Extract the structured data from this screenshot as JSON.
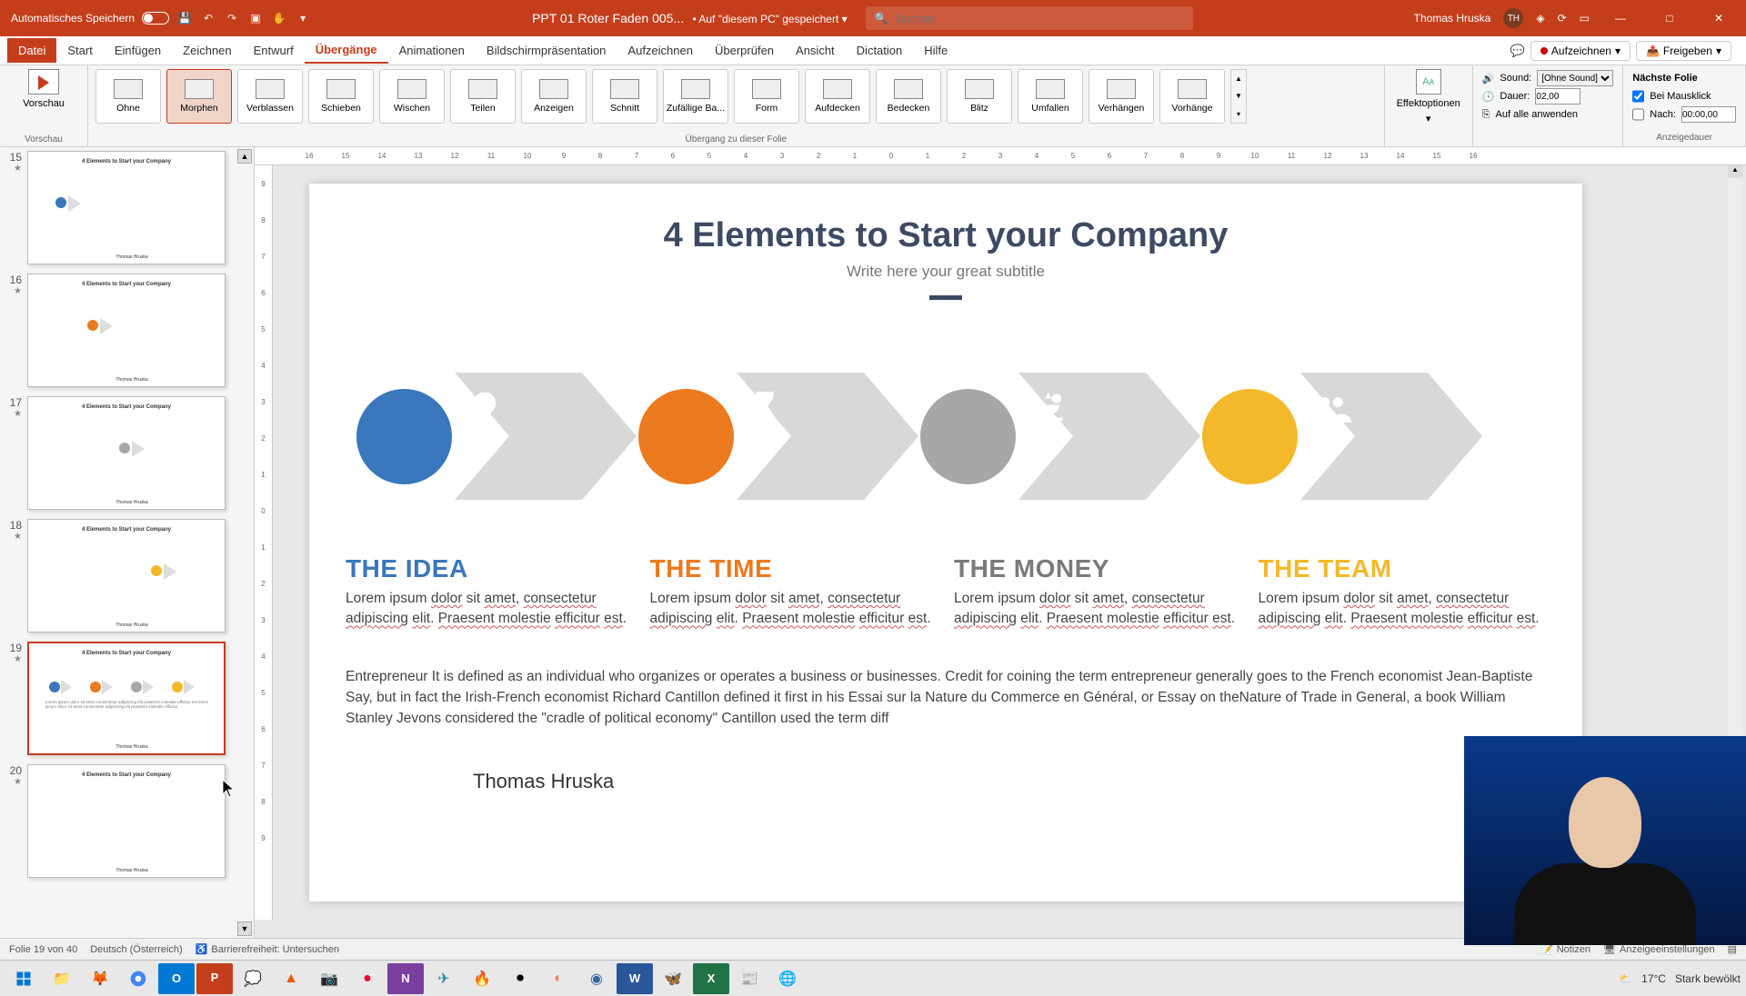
{
  "titlebar": {
    "autosave": "Automatisches Speichern",
    "filename": "PPT 01 Roter Faden 005...",
    "savedloc": "• Auf \"diesem PC\" gespeichert",
    "search_placeholder": "Suchen",
    "user": "Thomas Hruska",
    "user_initials": "TH"
  },
  "tabs": {
    "file": "Datei",
    "start": "Start",
    "insert": "Einfügen",
    "draw": "Zeichnen",
    "design": "Entwurf",
    "transitions": "Übergänge",
    "animations": "Animationen",
    "slideshow": "Bildschirmpräsentation",
    "record": "Aufzeichnen",
    "review": "Überprüfen",
    "view": "Ansicht",
    "dictation": "Dictation",
    "help": "Hilfe",
    "recordBtn": "Aufzeichnen",
    "shareBtn": "Freigeben"
  },
  "ribbon": {
    "preview": "Vorschau",
    "trans": [
      "Ohne",
      "Morphen",
      "Verblassen",
      "Schieben",
      "Wischen",
      "Teilen",
      "Anzeigen",
      "Schnitt",
      "Zufällige Ba...",
      "Form",
      "Aufdecken",
      "Bedecken",
      "Blitz",
      "Umfallen",
      "Verhängen",
      "Vorhänge"
    ],
    "effectOptions": "Effektoptionen",
    "groupLabel": "Übergang zu dieser Folie",
    "sound": "Sound:",
    "soundVal": "[Ohne Sound]",
    "duration": "Dauer:",
    "durationVal": "02,00",
    "applyAll": "Auf alle anwenden",
    "nextSlide": "Nächste Folie",
    "onClick": "Bei Mausklick",
    "after": "Nach:",
    "afterVal": "00:00,00",
    "timingLabel": "Anzeigedauer"
  },
  "thumbs": {
    "nums": [
      "15",
      "16",
      "17",
      "18",
      "19",
      "20"
    ],
    "title": "4 Elements to Start your Company",
    "author": "Thomas Hruska"
  },
  "slide": {
    "title": "4 Elements to Start your Company",
    "subtitle": "Write here your great subtitle",
    "cols": [
      {
        "h": "THE IDEA",
        "c": "blue"
      },
      {
        "h": "THE TIME",
        "c": "orange"
      },
      {
        "h": "THE MONEY",
        "c": "gray"
      },
      {
        "h": "THE TEAM",
        "c": "yellow"
      }
    ],
    "lorem1": "Lorem ipsum ",
    "lorem_u1": "dolor",
    "lorem2": " sit ",
    "lorem_u2": "amet",
    "lorem3": ", ",
    "lorem_u3": "consectetur adipiscing",
    "lorem4": " ",
    "lorem_u4": "elit",
    "lorem5": ". ",
    "lorem_u5": "Praesent molestie",
    "lorem6": " ",
    "lorem_u6": "efficitur",
    "lorem7": " ",
    "lorem_u7": "est",
    "lorem8": ".",
    "entrepreneur": "Entrepreneur  It is defined as an individual who organizes or operates a business or businesses. Credit for coining the term entrepreneur generally goes to the French economist Jean-Baptiste Say, but in fact the Irish-French economist Richard Cantillon defined it first in his Essai sur la Nature du Commerce en Général, or Essay on theNature of Trade in General, a book William Stanley Jevons considered the \"cradle of political economy\" Cantillon used the term diff",
    "author": "Thomas Hruska"
  },
  "statusbar": {
    "slideOf": "Folie 19 von 40",
    "lang": "Deutsch (Österreich)",
    "accessibility": "Barrierefreiheit: Untersuchen",
    "notes": "Notizen",
    "displaySettings": "Anzeigeeinstellungen"
  },
  "taskbar": {
    "temp": "17°C",
    "weather": "Stark bewölkt"
  },
  "ruler_h": [
    "16",
    "15",
    "14",
    "13",
    "12",
    "11",
    "10",
    "9",
    "8",
    "7",
    "6",
    "5",
    "4",
    "3",
    "2",
    "1",
    "0",
    "1",
    "2",
    "3",
    "4",
    "5",
    "6",
    "7",
    "8",
    "9",
    "10",
    "11",
    "12",
    "13",
    "14",
    "15",
    "16"
  ],
  "ruler_v": [
    "9",
    "8",
    "7",
    "6",
    "5",
    "4",
    "3",
    "2",
    "1",
    "0",
    "1",
    "2",
    "3",
    "4",
    "5",
    "6",
    "7",
    "8",
    "9"
  ]
}
